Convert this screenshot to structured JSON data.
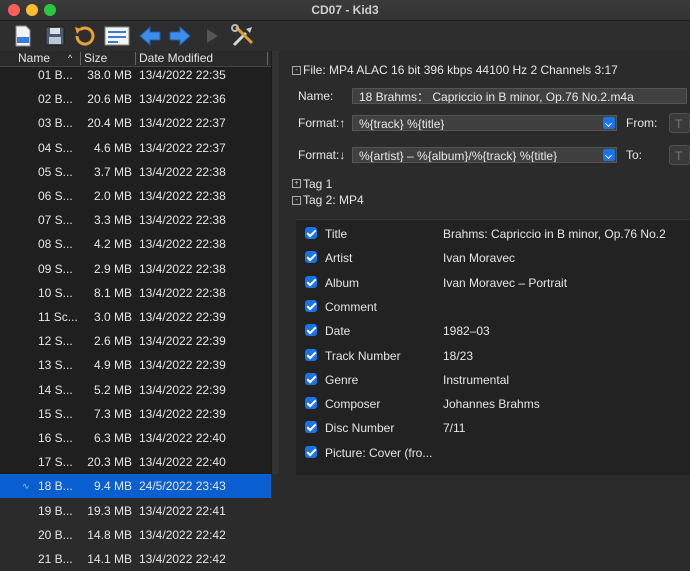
{
  "window": {
    "title": "CD07 - Kid3"
  },
  "toolbar": {
    "icons": [
      "new-file-icon",
      "save-icon",
      "revert-icon",
      "settings-panel-icon",
      "previous-icon",
      "next-icon",
      "play-icon",
      "tools-icon"
    ]
  },
  "file_list": {
    "columns": {
      "name": "Name",
      "size": "Size",
      "date": "Date Modified"
    },
    "rows": [
      {
        "name": "01 B...",
        "size": "38.0 MB",
        "date": "13/4/2022 22:35"
      },
      {
        "name": "02 B...",
        "size": "20.6 MB",
        "date": "13/4/2022 22:36"
      },
      {
        "name": "03 B...",
        "size": "20.4 MB",
        "date": "13/4/2022 22:37"
      },
      {
        "name": "04 S...",
        "size": "4.6 MB",
        "date": "13/4/2022 22:37"
      },
      {
        "name": "05 S...",
        "size": "3.7 MB",
        "date": "13/4/2022 22:38"
      },
      {
        "name": "06 S...",
        "size": "2.0 MB",
        "date": "13/4/2022 22:38"
      },
      {
        "name": "07 S...",
        "size": "3.3 MB",
        "date": "13/4/2022 22:38"
      },
      {
        "name": "08 S...",
        "size": "4.2 MB",
        "date": "13/4/2022 22:38"
      },
      {
        "name": "09 S...",
        "size": "2.9 MB",
        "date": "13/4/2022 22:38"
      },
      {
        "name": "10 S...",
        "size": "8.1 MB",
        "date": "13/4/2022 22:38"
      },
      {
        "name": "11 Sc...",
        "size": "3.0 MB",
        "date": "13/4/2022 22:39"
      },
      {
        "name": "12 S...",
        "size": "2.6 MB",
        "date": "13/4/2022 22:39"
      },
      {
        "name": "13 S...",
        "size": "4.9 MB",
        "date": "13/4/2022 22:39"
      },
      {
        "name": "14 S...",
        "size": "5.2 MB",
        "date": "13/4/2022 22:39"
      },
      {
        "name": "15 S...",
        "size": "7.3 MB",
        "date": "13/4/2022 22:39"
      },
      {
        "name": "16 S...",
        "size": "6.3 MB",
        "date": "13/4/2022 22:40"
      },
      {
        "name": "17 S...",
        "size": "20.3 MB",
        "date": "13/4/2022 22:40"
      },
      {
        "name": "18 B...",
        "size": "9.4 MB",
        "date": "24/5/2022 23:43",
        "selected": true,
        "mark": "∿"
      },
      {
        "name": "19 B...",
        "size": "19.3 MB",
        "date": "13/4/2022 22:41"
      },
      {
        "name": "20 B...",
        "size": "14.8 MB",
        "date": "13/4/2022 22:42"
      },
      {
        "name": "21 B...",
        "size": "14.1 MB",
        "date": "13/4/2022 22:42"
      }
    ]
  },
  "file_panel": {
    "file_info": "File: MP4 ALAC 16 bit 396 kbps 44100 Hz 2 Channels 3:17",
    "name_label": "Name:",
    "name_value": "18 Brahms： Capriccio in B minor, Op.76 No.2.m4a",
    "format_up_label": "Format:↑",
    "format_up_value": "%{track} %{title}",
    "from_label": "From:",
    "from_button": "T",
    "format_down_label": "Format:↓",
    "format_down_value": "%{artist} – %{album}/%{track} %{title}",
    "to_label": "To:",
    "to_button": "T",
    "tag1_label": "Tag 1",
    "tag2_label": "Tag 2: MP4"
  },
  "tags": [
    {
      "name": "Title",
      "value": "Brahms: Capriccio in B minor, Op.76 No.2"
    },
    {
      "name": "Artist",
      "value": "Ivan Moravec"
    },
    {
      "name": "Album",
      "value": "Ivan Moravec – Portrait"
    },
    {
      "name": "Comment",
      "value": ""
    },
    {
      "name": "Date",
      "value": "1982–03"
    },
    {
      "name": "Track Number",
      "value": "18/23"
    },
    {
      "name": "Genre",
      "value": "Instrumental"
    },
    {
      "name": "Composer",
      "value": "Johannes Brahms"
    },
    {
      "name": "Disc Number",
      "value": "7/11"
    },
    {
      "name": "Picture: Cover (fro...",
      "value": ""
    }
  ],
  "colors": {
    "selection": "#0a5fd0",
    "accent": "#1a73e8"
  }
}
